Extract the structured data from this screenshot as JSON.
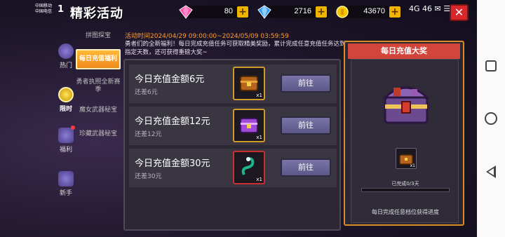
{
  "status": {
    "carrier_1": "中国移动",
    "carrier_2": "中国电信",
    "time": "1",
    "icons": "4G 46 ✉ ☰"
  },
  "app_title": "精彩活动",
  "currency": {
    "gem": "80",
    "diamond": "2716",
    "gold": "43670"
  },
  "colors": {
    "accent": "#f08a1a",
    "button": "#6c66a0",
    "header_red": "#d3443b",
    "close": "#d9262b"
  },
  "rail": [
    {
      "label": "热门",
      "icon": "fire-icon"
    },
    {
      "label": "限时",
      "icon": "clock-icon"
    },
    {
      "label": "福利",
      "icon": "gift-icon"
    },
    {
      "label": "新手",
      "icon": "novice-icon"
    }
  ],
  "subtabs": [
    {
      "label": "拼图探宝"
    },
    {
      "label": "每日充值福利"
    },
    {
      "label": "勇者执照全新赛季"
    },
    {
      "label": "魔女武器秘宝"
    },
    {
      "label": "珍藏武器秘宝"
    }
  ],
  "event": {
    "time_line": "活动时间2024/04/29 09:00:00~2024/05/09 03:59:59",
    "description": "勇者们的全新福利！每日完成充值任务可获取精美奖励，累计完成任意充值任务达到指定天数，还可获得重磅大奖~"
  },
  "tasks": [
    {
      "title": "今日充值金额6元",
      "remaining": "还差6元",
      "reward_count": "x1",
      "button": "前往"
    },
    {
      "title": "今日充值金额12元",
      "remaining": "还差12元",
      "reward_count": "x1",
      "button": "前往"
    },
    {
      "title": "今日充值金额30元",
      "remaining": "还差30元",
      "reward_count": "x1",
      "button": "前往"
    }
  ],
  "prize": {
    "header": "每日充值大奖",
    "small_count": "x1",
    "progress_text": "已完成0/3天",
    "progress_fraction": 0,
    "note": "每日完成任意档位获得进度"
  }
}
